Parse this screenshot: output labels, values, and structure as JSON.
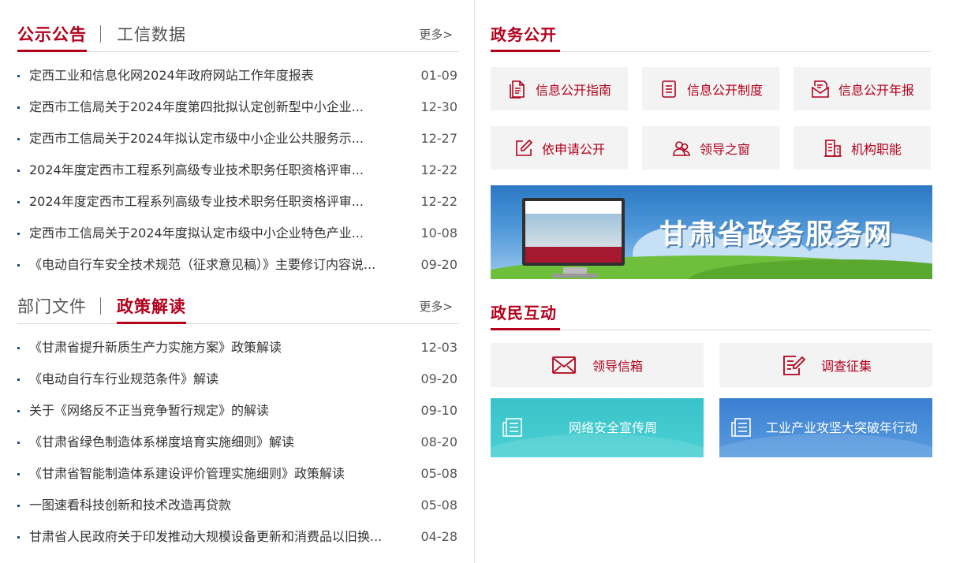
{
  "notice_panel": {
    "tabs": [
      {
        "label": "公示公告",
        "active": true
      },
      {
        "label": "工信数据",
        "active": false
      }
    ],
    "more": "更多>",
    "items": [
      {
        "title": "定西工业和信息化网2024年政府网站工作年度报表",
        "date": "01-09"
      },
      {
        "title": "定西市工信局关于2024年度第四批拟认定创新型中小企业...",
        "date": "12-30"
      },
      {
        "title": "定西市工信局关于2024年拟认定市级中小企业公共服务示...",
        "date": "12-27"
      },
      {
        "title": "2024年度定西市工程系列高级专业技术职务任职资格评审...",
        "date": "12-22"
      },
      {
        "title": "2024年度定西市工程系列高级专业技术职务任职资格评审...",
        "date": "12-22"
      },
      {
        "title": "定西市工信局关于2024年度拟认定市级中小企业特色产业...",
        "date": "10-08"
      },
      {
        "title": "《电动自行车安全技术规范（征求意见稿）》主要修订内容说...",
        "date": "09-20"
      }
    ]
  },
  "policy_panel": {
    "tabs": [
      {
        "label": "部门文件",
        "active": false
      },
      {
        "label": "政策解读",
        "active": true
      }
    ],
    "more": "更多>",
    "items": [
      {
        "title": "《甘肃省提升新质生产力实施方案》政策解读",
        "date": "12-03"
      },
      {
        "title": "《电动自行车行业规范条件》解读",
        "date": "09-20"
      },
      {
        "title": "关于《网络反不正当竞争暂行规定》的解读",
        "date": "09-10"
      },
      {
        "title": "《甘肃省绿色制造体系梯度培育实施细则》解读",
        "date": "08-20"
      },
      {
        "title": "《甘肃省智能制造体系建设评价管理实施细则》政策解读",
        "date": "05-08"
      },
      {
        "title": "一图速看科技创新和技术改造再贷款",
        "date": "05-08"
      },
      {
        "title": "甘肃省人民政府关于印发推动大规模设备更新和消费品以旧换...",
        "date": "04-28"
      }
    ]
  },
  "gov_open": {
    "title": "政务公开",
    "tiles": [
      {
        "label": "信息公开指南",
        "icon": "document-guide-icon"
      },
      {
        "label": "信息公开制度",
        "icon": "document-list-icon"
      },
      {
        "label": "信息公开年报",
        "icon": "report-envelope-icon"
      },
      {
        "label": "依申请公开",
        "icon": "edit-icon"
      },
      {
        "label": "领导之窗",
        "icon": "leaders-icon"
      },
      {
        "label": "机构职能",
        "icon": "building-icon"
      }
    ]
  },
  "banner": {
    "title": "甘肃省政务服务网"
  },
  "interaction": {
    "title": "政民互动",
    "tiles": [
      {
        "label": "领导信箱",
        "icon": "mail-icon"
      },
      {
        "label": "调查征集",
        "icon": "survey-icon"
      }
    ],
    "features": [
      {
        "label": "网络安全宣传周",
        "icon": "newspaper-icon",
        "color": "#3ec7cc"
      },
      {
        "label": "工业产业攻坚大突破年行动",
        "icon": "newspaper-icon",
        "color": "#4a8ed9"
      }
    ]
  },
  "colors": {
    "accent": "#b3001b",
    "bullet": "#1f4a8a"
  }
}
